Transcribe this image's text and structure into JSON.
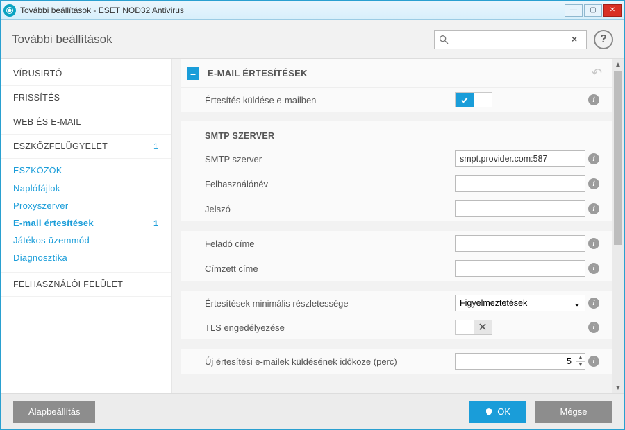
{
  "window": {
    "title": "További beállítások - ESET NOD32 Antivirus"
  },
  "header": {
    "heading": "További beállítások",
    "search_value": "",
    "search_placeholder": ""
  },
  "sidebar": {
    "items": [
      {
        "label": "VÍRUSIRTÓ"
      },
      {
        "label": "FRISSÍTÉS"
      },
      {
        "label": "WEB ÉS E-MAIL"
      },
      {
        "label": "ESZKÖZFELÜGYELET",
        "badge": "1"
      }
    ],
    "tools_label": "ESZKÖZÖK",
    "subitems": [
      {
        "label": "Naplófájlok"
      },
      {
        "label": "Proxyszerver"
      },
      {
        "label": "E-mail értesítések",
        "badge": "1",
        "active": true
      },
      {
        "label": "Játékos üzemmód"
      },
      {
        "label": "Diagnosztika"
      }
    ],
    "ui_label": "FELHASZNÁLÓI FELÜLET"
  },
  "panel": {
    "group_title": "E-MAIL ÉRTESÍTÉSEK",
    "send_email_label": "Értesítés küldése e-mailben",
    "send_email_on": true,
    "smtp_heading": "SMTP SZERVER",
    "smtp_server_label": "SMTP szerver",
    "smtp_server_value": "smpt.provider.com:587",
    "user_label": "Felhasználónév",
    "user_value": "",
    "pass_label": "Jelszó",
    "pass_value": "",
    "from_label": "Feladó címe",
    "from_value": "",
    "to_label": "Címzett címe",
    "to_value": "",
    "verbosity_label": "Értesítések minimális részletessége",
    "verbosity_value": "Figyelmeztetések",
    "tls_label": "TLS engedélyezése",
    "tls_on": false,
    "interval_label": "Új értesítési e-mailek küldésének időköze (perc)",
    "interval_value": "5"
  },
  "footer": {
    "default": "Alapbeállítás",
    "ok": "OK",
    "cancel": "Mégse"
  }
}
